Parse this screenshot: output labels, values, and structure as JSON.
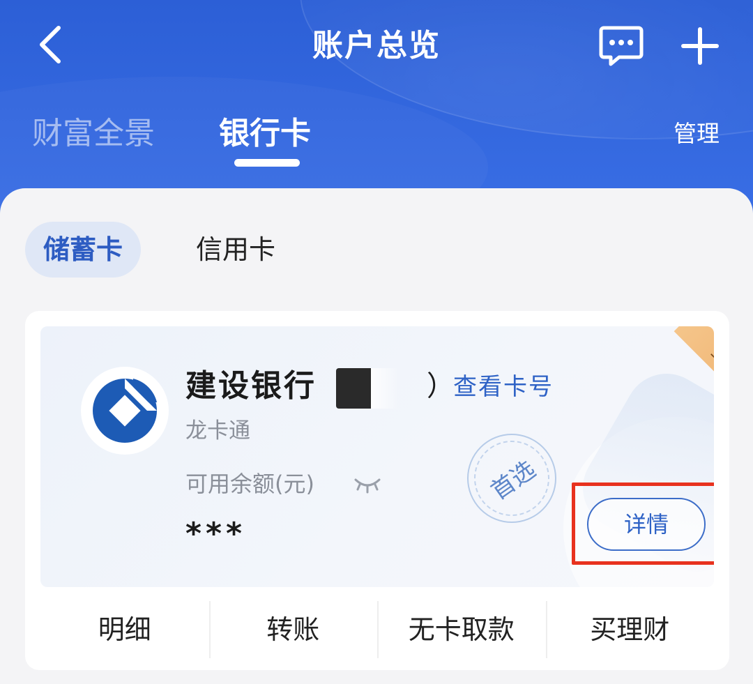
{
  "header": {
    "title": "账户总览",
    "back_icon": "chevron-left-icon",
    "message_icon": "message-dots-icon",
    "add_icon": "plus-icon"
  },
  "top_tabs": [
    {
      "label": "财富全景",
      "active": false
    },
    {
      "label": "银行卡",
      "active": true
    }
  ],
  "manage_label": "管理",
  "sub_tabs": [
    {
      "label": "储蓄卡",
      "active": true
    },
    {
      "label": "信用卡",
      "active": false
    }
  ],
  "card": {
    "bank_name": "建设银行",
    "open_paren": "（",
    "close_paren": "）",
    "view_card_number": "查看卡号",
    "card_type": "龙卡通",
    "signed_badge": "签约",
    "preferred_stamp": "首选",
    "balance_label": "可用余额(元)",
    "balance_value": "***",
    "detail_button": "详情",
    "logo_icon": "ccb-logo-icon",
    "eye_icon": "eye-closed-icon"
  },
  "actions": [
    {
      "label": "明细"
    },
    {
      "label": "转账"
    },
    {
      "label": "无卡取款"
    },
    {
      "label": "买理财"
    }
  ],
  "colors": {
    "header_blue": "#2c5fd6",
    "accent_blue": "#2e62c6",
    "highlight_red": "#e8321e",
    "ribbon_orange": "#eeb06d"
  }
}
